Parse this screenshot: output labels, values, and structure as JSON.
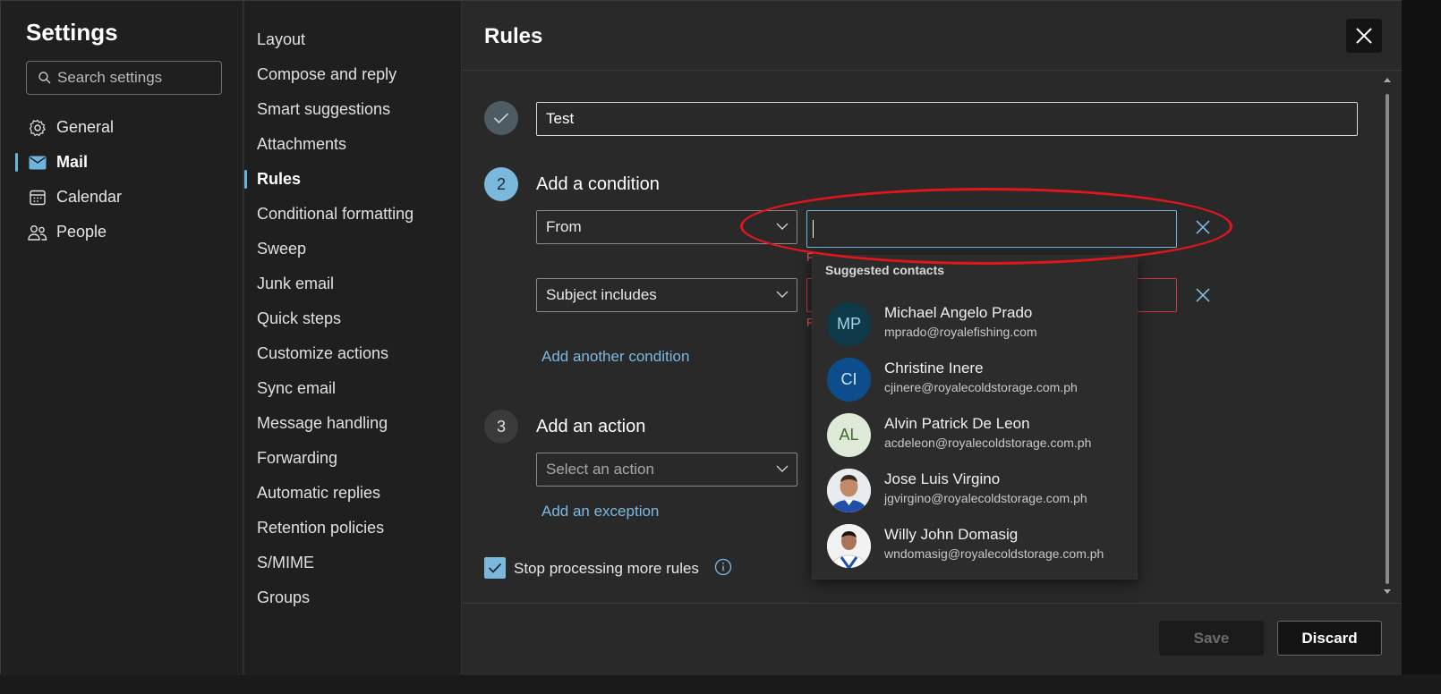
{
  "settings": {
    "title": "Settings",
    "search_placeholder": "Search settings",
    "nav": [
      {
        "label": "General",
        "icon": "gear-icon"
      },
      {
        "label": "Mail",
        "icon": "mail-icon",
        "active": true
      },
      {
        "label": "Calendar",
        "icon": "calendar-icon"
      },
      {
        "label": "People",
        "icon": "people-icon"
      }
    ]
  },
  "mail_nav": [
    "Layout",
    "Compose and reply",
    "Smart suggestions",
    "Attachments",
    "Rules",
    "Conditional formatting",
    "Sweep",
    "Junk email",
    "Quick steps",
    "Customize actions",
    "Sync email",
    "Message handling",
    "Forwarding",
    "Automatic replies",
    "Retention policies",
    "S/MIME",
    "Groups"
  ],
  "mail_nav_active": "Rules",
  "rules": {
    "title": "Rules",
    "rule_name": "Test",
    "step2_number": "2",
    "step2_title": "Add a condition",
    "condition1_field": "From",
    "condition2_field": "Subject includes",
    "add_condition_link": "Add another condition",
    "step3_number": "3",
    "step3_title": "Add an action",
    "action_placeholder": "Select an action",
    "add_exception_link": "Add an exception",
    "stop_processing_label": "Stop processing more rules",
    "stop_processing_checked": true,
    "save_label": "Save",
    "discard_label": "Discard"
  },
  "suggestions": {
    "title": "Suggested contacts",
    "contacts": [
      {
        "initials": "MP",
        "name": "Michael Angelo Prado",
        "email": "mprado@royalefishing.com",
        "bg": "#0f3a4a",
        "fg": "#9fd6ea"
      },
      {
        "initials": "CI",
        "name": "Christine Inere",
        "email": "cjinere@royalecoldstorage.com.ph",
        "bg": "#0e4d8c",
        "fg": "#cfe4f7"
      },
      {
        "initials": "AL",
        "name": "Alvin Patrick De Leon",
        "email": "acdeleon@royalecoldstorage.com.ph",
        "bg": "#dfe9d8",
        "fg": "#3f6b33"
      },
      {
        "initials": "",
        "name": "Jose Luis Virgino",
        "email": "jgvirgino@royalecoldstorage.com.ph",
        "bg": "#ffffff",
        "fg": "#333"
      },
      {
        "initials": "",
        "name": "Willy John Domasig",
        "email": "wndomasig@royalecoldstorage.com.ph",
        "bg": "#ffffff",
        "fg": "#333"
      }
    ]
  },
  "colors": {
    "accent": "#7ab8dc",
    "link": "#7cb8e4",
    "error": "#d13438",
    "annotation_ellipse": "#e1161c"
  }
}
